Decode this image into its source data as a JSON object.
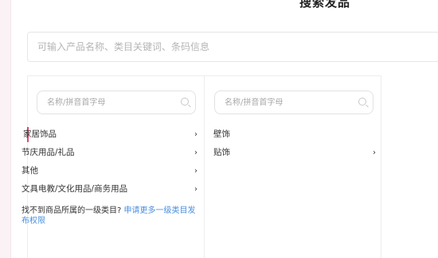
{
  "header": {
    "title": "搜索发品"
  },
  "search": {
    "placeholder": "可输入产品名称、类目关键词、条码信息"
  },
  "column1": {
    "search_placeholder": "名称/拼音首字母",
    "items": [
      {
        "label": "家居饰品",
        "chevron": "›",
        "active": true
      },
      {
        "label": "节庆用品/礼品",
        "chevron": "›"
      },
      {
        "label": "其他",
        "chevron": "›"
      },
      {
        "label": "文具电教/文化用品/商务用品",
        "chevron": "›"
      }
    ],
    "notice_text": "找不到商品所属的一级类目?",
    "notice_link": "申请更多一级类目发布权限"
  },
  "column2": {
    "search_placeholder": "名称/拼音首字母",
    "items": [
      {
        "label": "壁饰",
        "chevron": ""
      },
      {
        "label": "贴饰",
        "chevron": "›"
      }
    ]
  },
  "colors": {
    "accent": "#e0456f",
    "link": "#4a8fe0"
  }
}
